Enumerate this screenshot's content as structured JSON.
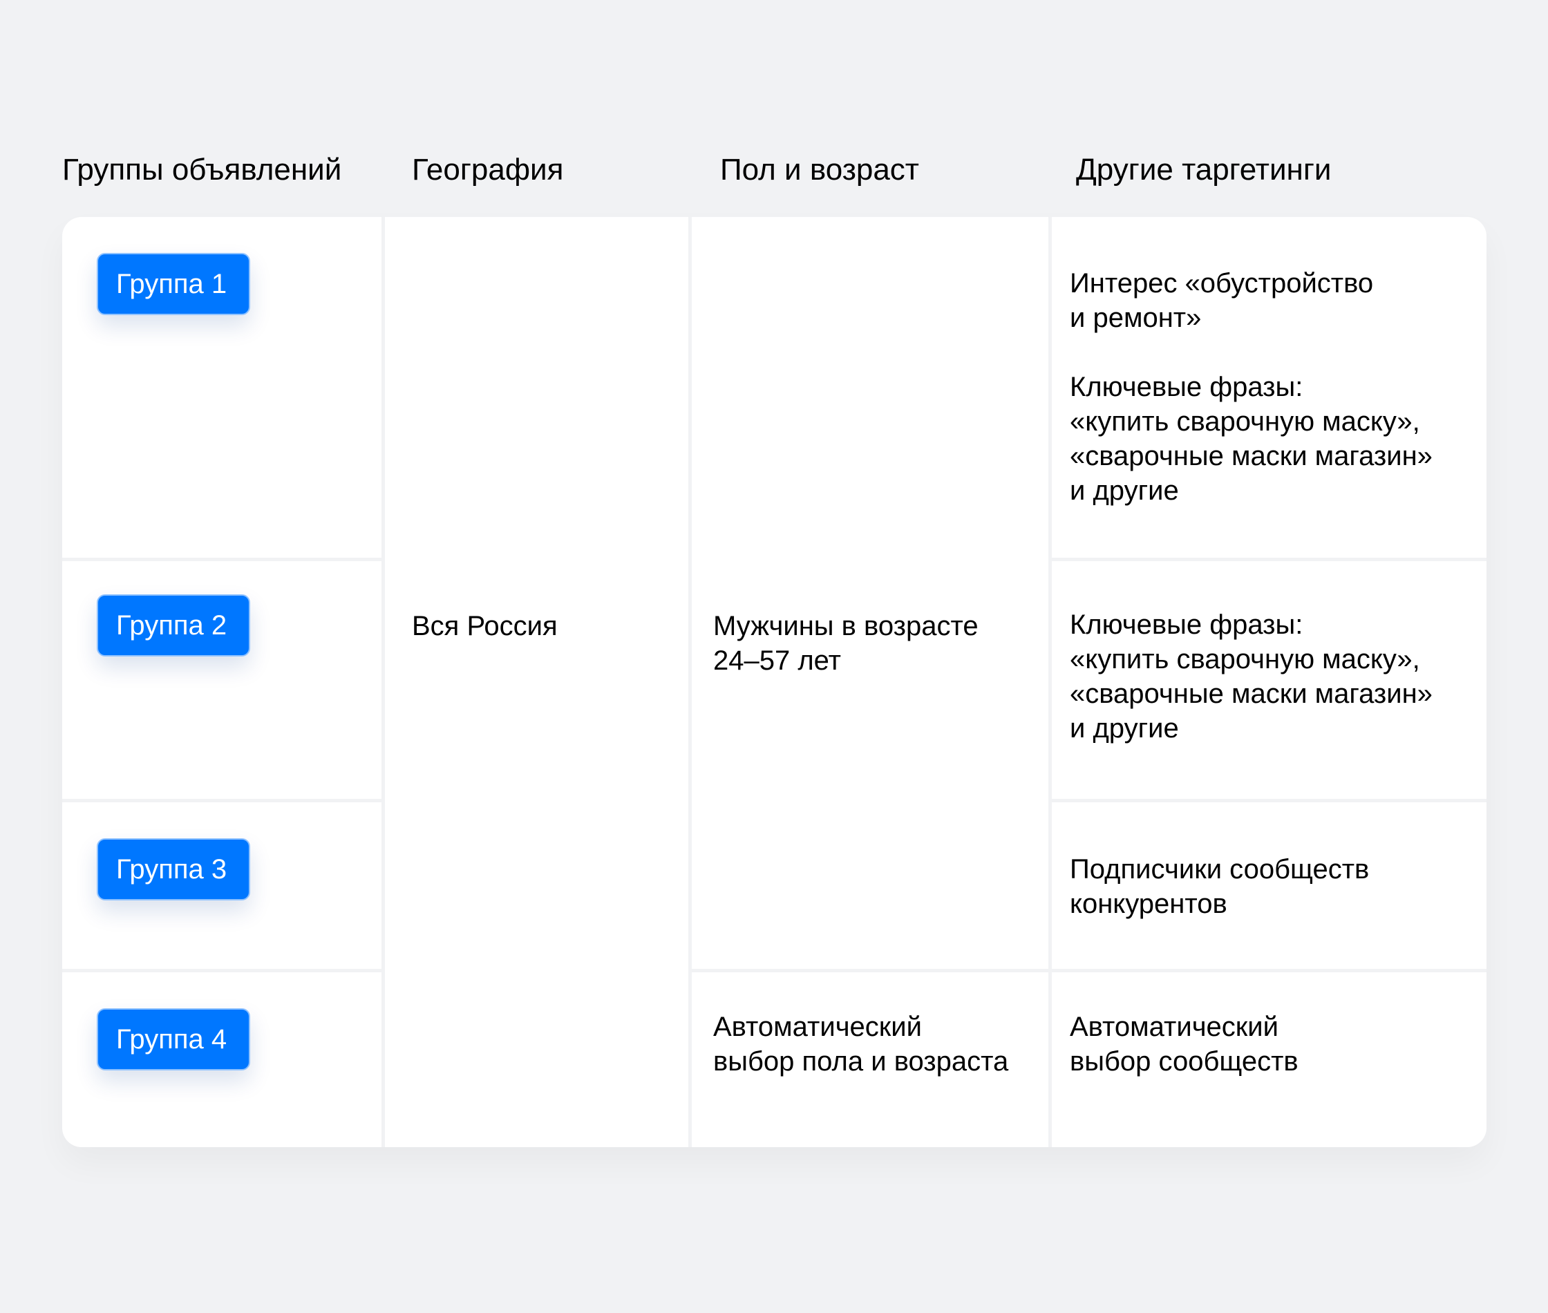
{
  "headers": {
    "groups": "Группы объявлений",
    "geography": "География",
    "demographics": "Пол и возраст",
    "other": "Другие таргетинги"
  },
  "groups": [
    {
      "label": "Группа 1"
    },
    {
      "label": "Группа 2"
    },
    {
      "label": "Группа 3"
    },
    {
      "label": "Группа 4"
    }
  ],
  "geography": {
    "value": "Вся Россия"
  },
  "demographics": {
    "groups_1_3": "Мужчины в возрасте\n24–57 лет",
    "group_4": "Автоматический\nвыбор пола и возраста"
  },
  "other_targeting": {
    "group_1_interest": "Интерес «обустройство\nи ремонт»",
    "group_1_keywords": "Ключевые фразы:\n«купить сварочную маску»,\n«сварочные маски магазин»\nи другие",
    "group_2_keywords": "Ключевые фразы:\n«купить сварочную маску»,\n«сварочные маски магазин»\nи другие",
    "group_3": "Подписчики сообществ\nконкурентов",
    "group_4": "Автоматический\nвыбор сообществ"
  },
  "colors": {
    "background": "#f1f2f4",
    "card": "#ffffff",
    "accent": "#0077ff",
    "text": "#000000"
  }
}
